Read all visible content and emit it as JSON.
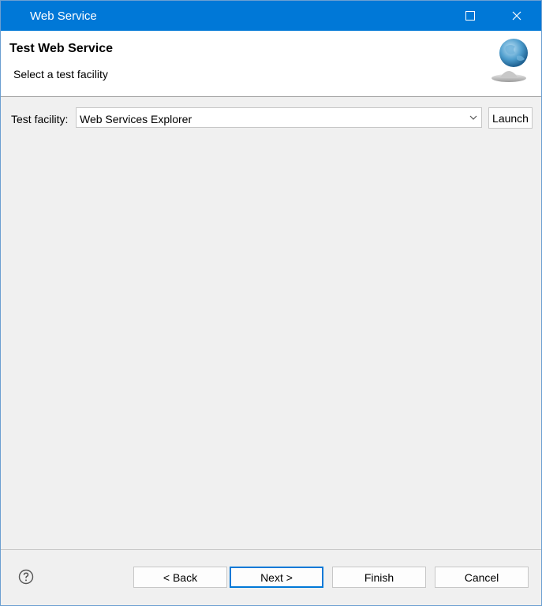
{
  "window": {
    "title": "Web Service"
  },
  "header": {
    "title": "Test Web Service",
    "subtitle": "Select a test facility",
    "icon": "globe-wizard-icon"
  },
  "form": {
    "facility_label": "Test facility:",
    "facility_value": "Web Services Explorer",
    "launch_label": "Launch"
  },
  "footer": {
    "help_icon": "question-mark-icon",
    "back_label": "< Back",
    "next_label": "Next >",
    "finish_label": "Finish",
    "cancel_label": "Cancel"
  },
  "colors": {
    "titlebar": "#0078d7",
    "accent": "#0078d7"
  }
}
